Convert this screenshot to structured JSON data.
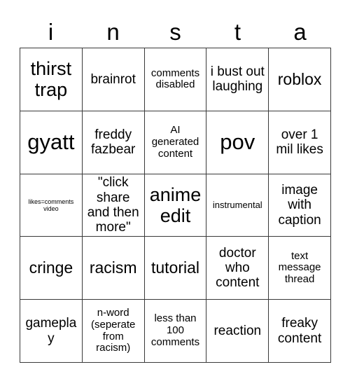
{
  "card": {
    "header_letters": [
      "i",
      "n",
      "s",
      "t",
      "a"
    ],
    "columns": 5,
    "rows": 5,
    "colors": {
      "background": "#ffffff",
      "text": "#000000",
      "grid_line": "#3a3a3a"
    },
    "cells": [
      {
        "text": "thirst trap",
        "size": "fs-xl"
      },
      {
        "text": "brainrot",
        "size": "fs-md"
      },
      {
        "text": "comments disabled",
        "size": "fs-sm"
      },
      {
        "text": "i bust out laughing",
        "size": "fs-md"
      },
      {
        "text": "roblox",
        "size": "fs-lg"
      },
      {
        "text": "gyatt",
        "size": "fs-xxl"
      },
      {
        "text": "freddy fazbear",
        "size": "fs-md"
      },
      {
        "text": "AI generated content",
        "size": "fs-sm"
      },
      {
        "text": "pov",
        "size": "fs-xxl"
      },
      {
        "text": "over 1 mil likes",
        "size": "fs-md"
      },
      {
        "text": "likes=comments video",
        "size": "fs-xxs"
      },
      {
        "text": "\"click share and then more\"",
        "size": "fs-md"
      },
      {
        "text": "anime edit",
        "size": "fs-xl"
      },
      {
        "text": "instrumental",
        "size": "fs-xs"
      },
      {
        "text": "image with caption",
        "size": "fs-md"
      },
      {
        "text": "cringe",
        "size": "fs-lg"
      },
      {
        "text": "racism",
        "size": "fs-lg"
      },
      {
        "text": "tutorial",
        "size": "fs-lg"
      },
      {
        "text": "doctor who content",
        "size": "fs-md"
      },
      {
        "text": "text message thread",
        "size": "fs-sm"
      },
      {
        "text": "gameplay",
        "size": "fs-md"
      },
      {
        "text": "n-word (seperate from racism)",
        "size": "fs-sm"
      },
      {
        "text": "less than 100 comments",
        "size": "fs-sm"
      },
      {
        "text": "reaction",
        "size": "fs-md"
      },
      {
        "text": "freaky content",
        "size": "fs-md"
      }
    ]
  }
}
